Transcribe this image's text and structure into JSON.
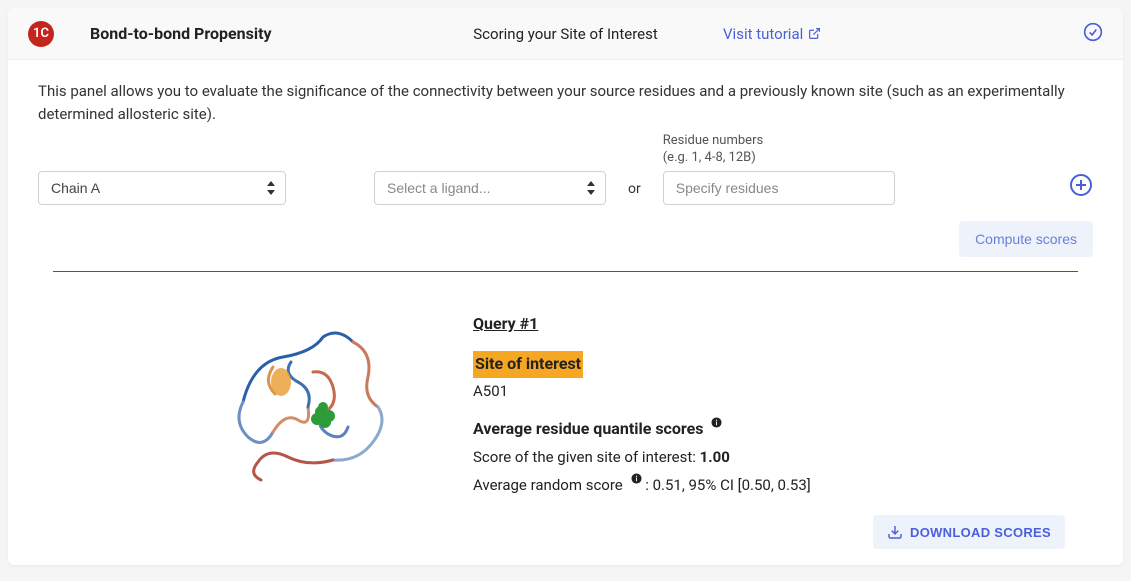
{
  "header": {
    "badge": "1C",
    "title": "Bond-to-bond Propensity",
    "subtitle": "Scoring your Site of Interest",
    "tutorial_link": "Visit tutorial"
  },
  "description": "This panel allows you to evaluate the significance of the connectivity between your source residues and a previously known site (such as an experimentally determined allosteric site).",
  "controls": {
    "chain_selected": "Chain A",
    "ligand_placeholder": "Select a ligand...",
    "or_text": "or",
    "residue_label_line1": "Residue numbers",
    "residue_label_line2": "(e.g. 1, 4-8, 12B)",
    "residue_placeholder": "Specify residues",
    "compute_label": "Compute scores"
  },
  "results": {
    "query_title": "Query #1",
    "soi_label": "Site of interest",
    "residue": "A501",
    "avg_heading": "Average residue quantile scores",
    "score_line_prefix": "Score of the given site of interest: ",
    "score_value": "1.00",
    "random_prefix": "Average random score",
    "random_stats": " : 0.51, 95% CI [0.50, 0.53]"
  },
  "download_label": "DOWNLOAD SCORES"
}
